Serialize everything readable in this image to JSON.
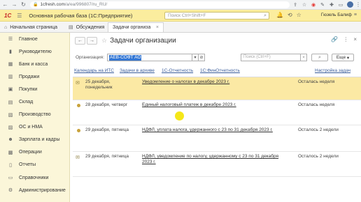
{
  "browser": {
    "url_host": "1cfresh.com",
    "url_path": "/a/ea/996807/ru_RU/"
  },
  "header": {
    "logo": "1С",
    "base_title": "Основная рабочая база  (1С:Предприятие)",
    "search_placeholder": "Поиск Ctrl+Shift+F",
    "user": "Гюзель Балиф"
  },
  "tabs": {
    "home": "Начальная страница",
    "discussions": "Обсуждения",
    "active": "Задачи организа"
  },
  "sidebar": {
    "items": [
      {
        "icon": "menu-icon",
        "label": "Главное"
      },
      {
        "icon": "chart-icon",
        "label": "Руководителю"
      },
      {
        "icon": "bank-icon",
        "label": "Банк и касса"
      },
      {
        "icon": "cart-icon",
        "label": "Продажи"
      },
      {
        "icon": "basket-icon",
        "label": "Покупки"
      },
      {
        "icon": "warehouse-icon",
        "label": "Склад"
      },
      {
        "icon": "factory-icon",
        "label": "Производство"
      },
      {
        "icon": "assets-icon",
        "label": "ОС и НМА"
      },
      {
        "icon": "people-icon",
        "label": "Зарплата и кадры"
      },
      {
        "icon": "operations-icon",
        "label": "Операции"
      },
      {
        "icon": "reports-icon",
        "label": "Отчеты"
      },
      {
        "icon": "book-icon",
        "label": "Справочники"
      },
      {
        "icon": "gear-icon",
        "label": "Администрирование"
      }
    ]
  },
  "main": {
    "title": "Задачи организации",
    "filter_label": "Организация:",
    "organization": "АЕВ-СОФТ АО",
    "search_placeholder": "Поиск (Ctrl+F)",
    "more_label": "Еще"
  },
  "links": {
    "calendar": "Календарь на ИТС",
    "archive": "Задачи в архиве",
    "reporting": "1С-Отчетность",
    "fin": "1С:ФинОтчетность",
    "settings": "Настройка задач"
  },
  "tasks": [
    {
      "date": "25 декабря, понедельник",
      "task": "Уведомление о налогах в декабре 2023 г.",
      "left": "Осталась неделя"
    },
    {
      "date": "28 декабря, четверг",
      "task": "Единый налоговый платеж в декабре 2023 г.",
      "left": "Осталась неделя"
    },
    {
      "date": "29 декабря, пятница",
      "task": "НДФЛ, уплата налога, удержанного с 23 по 31 декабря 2023 г.",
      "left": "Осталось 2 недели"
    },
    {
      "date": "29 декабря, пятница",
      "task": "НДФЛ, уведомление по налогу, удержанному с 23 по 31 декабря 2023 г.",
      "left": "Осталось 2 недели"
    }
  ]
}
